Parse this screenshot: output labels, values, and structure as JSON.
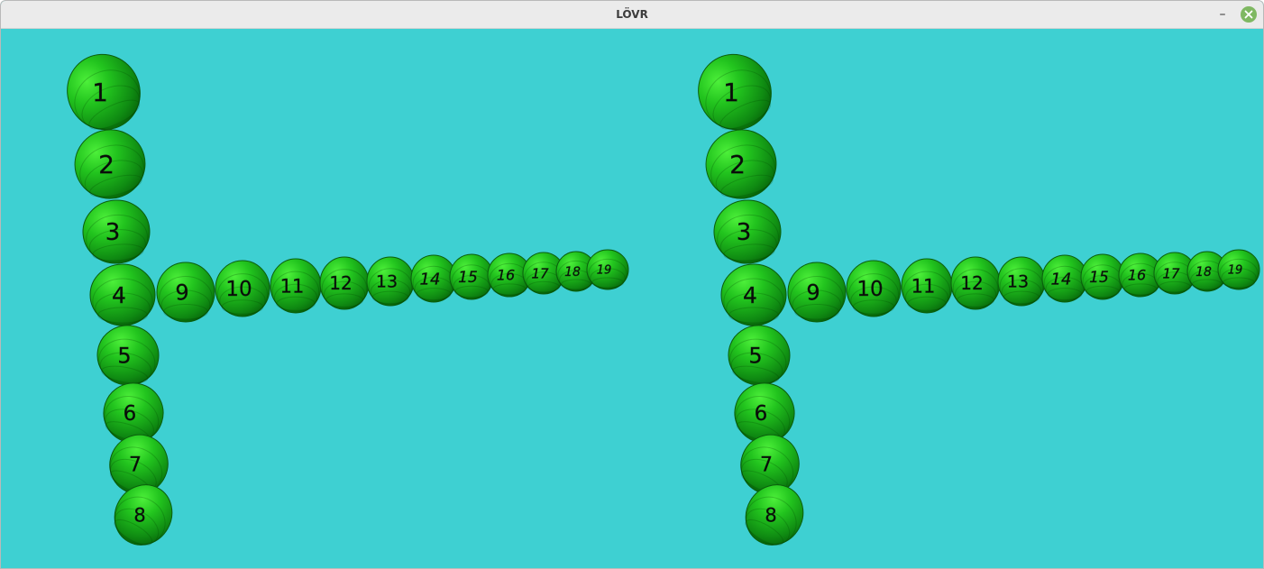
{
  "window": {
    "title": "LÖVR",
    "minimize_label": "–",
    "close_icon": "close-icon"
  },
  "scene": {
    "background_color": "#3ed0d2",
    "sphere_color": "#22c41e",
    "views": [
      {
        "name": "left-eye",
        "labels": [
          "1",
          "2",
          "3",
          "4",
          "5",
          "6",
          "7",
          "8",
          "9",
          "10",
          "11",
          "12",
          "13",
          "14",
          "15",
          "16",
          "17",
          "18",
          "19"
        ]
      },
      {
        "name": "right-eye",
        "labels": [
          "1",
          "2",
          "3",
          "4",
          "5",
          "6",
          "7",
          "8",
          "9",
          "10",
          "11",
          "12",
          "13",
          "14",
          "15",
          "16",
          "17",
          "18",
          "19"
        ]
      }
    ]
  }
}
